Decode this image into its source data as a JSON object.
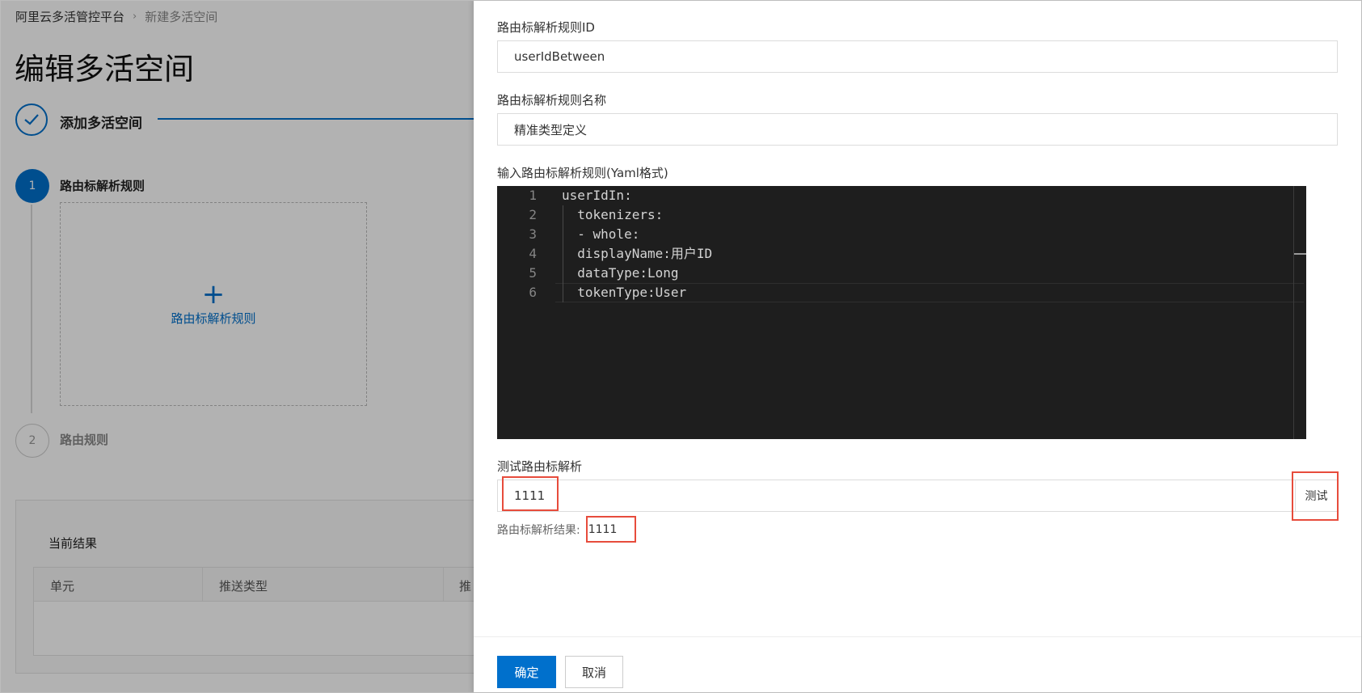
{
  "breadcrumb": {
    "root": "阿里云多活管控平台",
    "current": "新建多活空间"
  },
  "page": {
    "title": "编辑多活空间"
  },
  "steps": {
    "top_label": "添加多活空间",
    "sub": [
      {
        "number": "1",
        "label": "路由标解析规则"
      },
      {
        "number": "2",
        "label": "路由规则"
      }
    ],
    "add_box_label": "路由标解析规则"
  },
  "result_card": {
    "title": "当前结果",
    "columns": [
      "单元",
      "推送类型",
      "推"
    ]
  },
  "drawer": {
    "rule_id_label": "路由标解析规则ID",
    "rule_id_value": "userIdBetween",
    "rule_name_label": "路由标解析规则名称",
    "rule_name_value": "精准类型定义",
    "yaml_label": "输入路由标解析规则(Yaml格式)",
    "yaml_lines": [
      {
        "no": "1",
        "text": "userIdIn:"
      },
      {
        "no": "2",
        "text": "  tokenizers:"
      },
      {
        "no": "3",
        "text": "  - whole:"
      },
      {
        "no": "4",
        "text": "  displayName:用户ID"
      },
      {
        "no": "5",
        "text": "  dataType:Long"
      },
      {
        "no": "6",
        "text": "  tokenType:User"
      }
    ],
    "test_label": "测试路由标解析",
    "test_value": "1111",
    "test_button": "测试",
    "result_label": "路由标解析结果:",
    "result_value": "1111",
    "confirm_button": "确定",
    "cancel_button": "取消"
  },
  "colors": {
    "primary": "#0070cc",
    "highlight": "#e74c3c",
    "editor_bg": "#1e1e1e"
  }
}
